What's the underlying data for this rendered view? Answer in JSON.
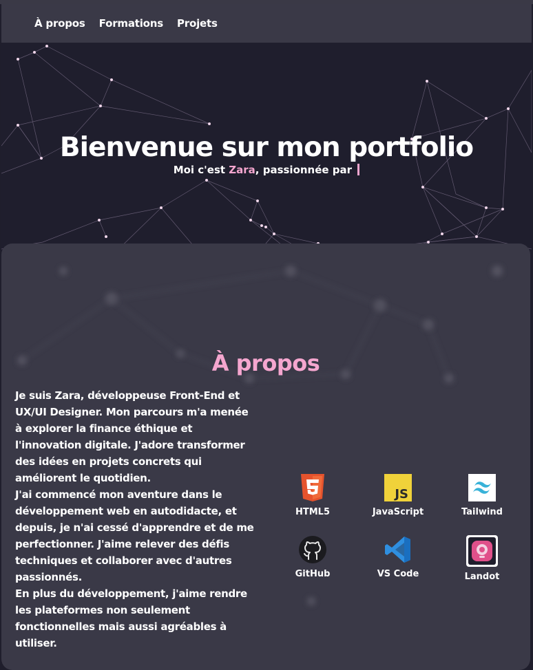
{
  "nav": {
    "items": [
      "À propos",
      "Formations",
      "Projets"
    ]
  },
  "hero": {
    "title": "Bienvenue sur mon portfolio",
    "subtitle_prefix": "Moi c'est ",
    "name": "Zara",
    "subtitle_suffix": ", passionnée par "
  },
  "about": {
    "title": "À propos",
    "paragraphs": [
      "Je suis Zara, développeuse Front-End et UX/UI Designer. Mon parcours m'a menée à explorer la finance éthique et l'innovation digitale. J'adore transformer des idées en projets concrets qui améliorent le quotidien.",
      "J'ai commencé mon aventure dans le développement web en autodidacte, et depuis, je n'ai cessé d'apprendre et de me perfectionner. J'aime relever des défis techniques et collaborer avec d'autres passionnés.",
      "En plus du développement, j'aime rendre les plateformes non seulement fonctionnelles mais aussi agréables à utiliser."
    ]
  },
  "skills": [
    {
      "label": "HTML5",
      "icon": "html5-icon"
    },
    {
      "label": "JavaScript",
      "icon": "javascript-icon"
    },
    {
      "label": "Tailwind",
      "icon": "tailwind-icon"
    },
    {
      "label": "GitHub",
      "icon": "github-icon"
    },
    {
      "label": "VS Code",
      "icon": "vscode-icon"
    },
    {
      "label": "Landot",
      "icon": "landot-icon"
    }
  ],
  "colors": {
    "accent": "#f5a6cf",
    "background": "#1f1e2c",
    "panel": "#3a3947"
  }
}
